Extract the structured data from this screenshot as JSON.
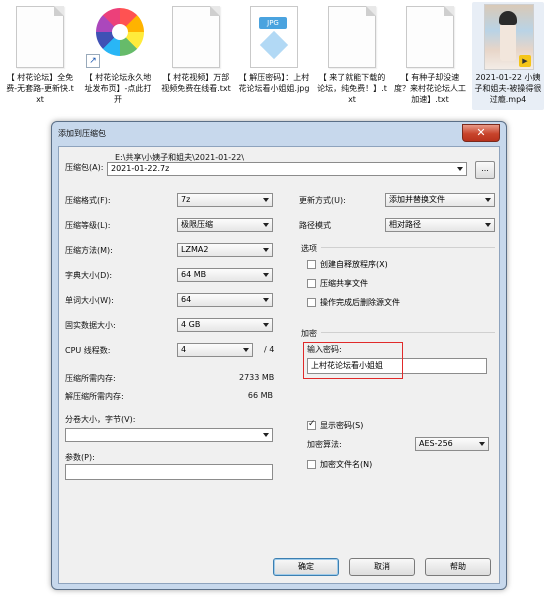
{
  "files": [
    {
      "name": "【 村花论坛】全免费-无套路-更新快.txt",
      "icon": "text-file-icon"
    },
    {
      "name": "【 村花论坛永久地址发布页】-点此打开",
      "icon": "pinwheel-shortcut-icon"
    },
    {
      "name": "【 村花视频】万部视频免费在线看.txt",
      "icon": "text-file-icon"
    },
    {
      "name": "【 解压密码】：上村花论坛看小姐姐.jpg",
      "icon": "jpg-file-icon"
    },
    {
      "name": "【 来了就能下载的论坛，纯免费！】.txt",
      "icon": "text-file-icon"
    },
    {
      "name": "【 有种子却没速度？来村花论坛人工加速】.txt",
      "icon": "text-file-icon"
    },
    {
      "name": "2021-01-22 小姨子和姐夫-被操得很过瘾.mp4",
      "icon": "video-thumbnail"
    }
  ],
  "dialog": {
    "title": "添加到压缩包",
    "close": "✕",
    "archive_label": "压缩包(A):",
    "archive_path": "E:\\共享\\小姨子和姐夫\\2021-01-22\\",
    "archive_name": "2021-01-22.7z",
    "browse": "...",
    "left": [
      {
        "label": "压缩格式(F):",
        "value": "7z"
      },
      {
        "label": "压缩等级(L):",
        "value": "极限压缩"
      },
      {
        "label": "压缩方法(M):",
        "value": "LZMA2"
      },
      {
        "label": "字典大小(D):",
        "value": "64 MB"
      },
      {
        "label": "单词大小(W):",
        "value": "64"
      },
      {
        "label": "固实数据大小:",
        "value": "4 GB"
      }
    ],
    "cpu_label": "CPU 线程数:",
    "cpu_value": "4",
    "cpu_total": "/ 4",
    "mem_compress_label": "压缩所需内存:",
    "mem_compress_value": "2733 MB",
    "mem_decompress_label": "解压缩所需内存:",
    "mem_decompress_value": "66 MB",
    "split_label": "分卷大小，字节(V):",
    "params_label": "参数(P):",
    "update_label": "更新方式(U):",
    "update_value": "添加并替换文件",
    "pathmode_label": "路径模式",
    "pathmode_value": "相对路径",
    "options_title": "选项",
    "opt_sfx": "创建自释放程序(X)",
    "opt_shared": "压缩共享文件",
    "opt_delete": "操作完成后删除源文件",
    "encrypt_title": "加密",
    "password_label": "输入密码:",
    "password_value": "上村花论坛看小姐姐",
    "show_password": "显示密码(S)",
    "encrypt_method_label": "加密算法:",
    "encrypt_method_value": "AES-256",
    "encrypt_names": "加密文件名(N)",
    "ok": "确定",
    "cancel": "取消",
    "help": "帮助"
  }
}
